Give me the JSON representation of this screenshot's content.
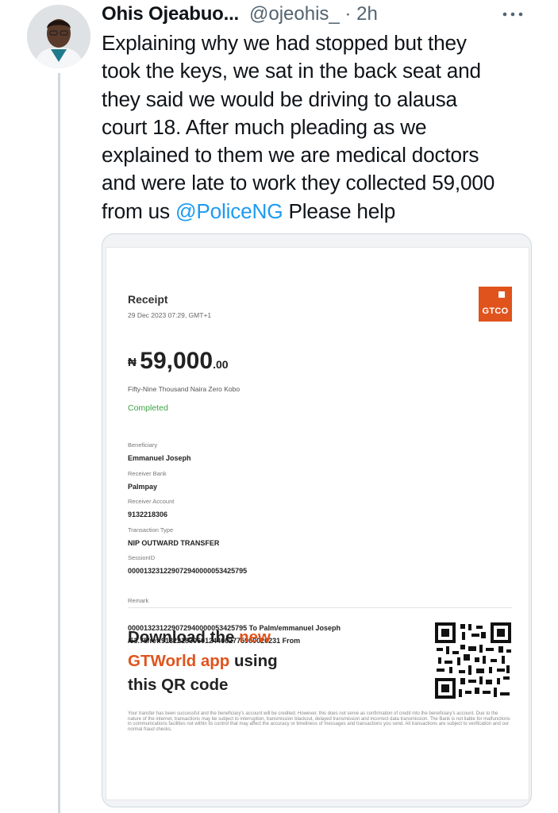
{
  "tweet": {
    "author_name": "Ohis Ojeabuo...",
    "handle_time": "@ojeohis_ · 2h",
    "text_before_mention": "Explaining why we had stopped but they\ntook the keys, we sat in the back seat and\nthey said we would be driving to alausa\ncourt 18. After much pleading as we\nexplained to them we are medical doctors\nand were late to work they collected 59,000\nfrom us ",
    "mention": "@PoliceNG",
    "text_after_mention": " Please help",
    "more_icon": "more-horizontal-icon"
  },
  "receipt": {
    "title": "Receipt",
    "date": "29 Dec 2023 07:29, GMT+1",
    "logo_text": "GTCO",
    "currency_symbol": "₦",
    "amount_main": "59,000",
    "amount_decimal": ".00",
    "amount_words": "Fifty-Nine Thousand Naira Zero Kobo",
    "status": "Completed",
    "status_color": "#3ca545",
    "brand_color": "#e0531d",
    "fields": [
      {
        "label": "Beneficiary",
        "value": "Emmanuel Joseph"
      },
      {
        "label": "Receiver Bank",
        "value": "Palmpay"
      },
      {
        "label": "Receiver Account",
        "value": "9132218306"
      },
      {
        "label": "Transaction Type",
        "value": "NIP OUTWARD TRANSFER"
      },
      {
        "label": "SessionID",
        "value": "000013231229072940000053425795"
      },
      {
        "label": "Remark",
        "value": "000013231229072940000053425795 To Palm/emmanuel Joseph\n/53.75/ref:913221830601244662775900020231 From"
      }
    ],
    "promo_line1_a": "Download the ",
    "promo_line1_b": "new",
    "promo_line2_a": "GTWorld app",
    "promo_line2_b": " using",
    "promo_line3": "this QR code",
    "disclaimer": "Your transfer has been successful and the beneficiary's account will be credited. However, this does not serve as confirmation of credit into the beneficiary's account. Due to the nature of the internet, transactions may be subject to interruption, transmission blackout, delayed transmission and incorrect data transmission. The Bank is not liable for malfunctions in communications facilities not within its control that may affect the accuracy or timeliness of messages and transactions you send. All transactions are subject to verification and our normal fraud checks."
  }
}
